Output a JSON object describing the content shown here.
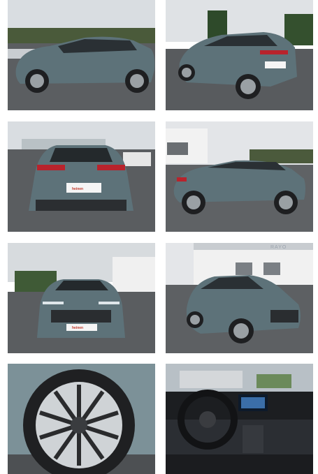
{
  "gallery": {
    "photos": [
      {
        "view": "side-front-left",
        "color": "#5d7279"
      },
      {
        "view": "rear-three-quarter",
        "color": "#5d7279"
      },
      {
        "view": "rear",
        "color": "#5d7279"
      },
      {
        "view": "side-rear-left",
        "color": "#5d7279"
      },
      {
        "view": "front",
        "color": "#5d7279"
      },
      {
        "view": "front-three-quarter",
        "color": "#5d7279"
      },
      {
        "view": "wheel-closeup",
        "color": "#7c9198"
      },
      {
        "view": "interior-dashboard",
        "color": "#2b2e33"
      }
    ],
    "plate_text": "heinen",
    "building_sign": "RAYO"
  }
}
